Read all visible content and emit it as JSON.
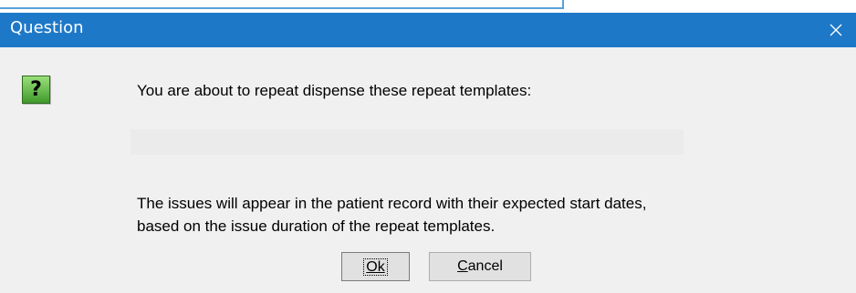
{
  "dialog": {
    "title": "Question",
    "icon": "question-mark-icon",
    "icon_glyph": "?",
    "message_line1": "You are about to repeat dispense these repeat templates:",
    "message_line2": "The issues will appear in the patient record with their expected start dates,",
    "message_line3": "based on the issue duration of the repeat templates.",
    "buttons": {
      "ok_label": "Ok",
      "cancel_label": "Cancel"
    }
  },
  "colors": {
    "titlebar": "#1e78c8",
    "body": "#f0f0f0",
    "icon_green": "#3f9a2b"
  }
}
